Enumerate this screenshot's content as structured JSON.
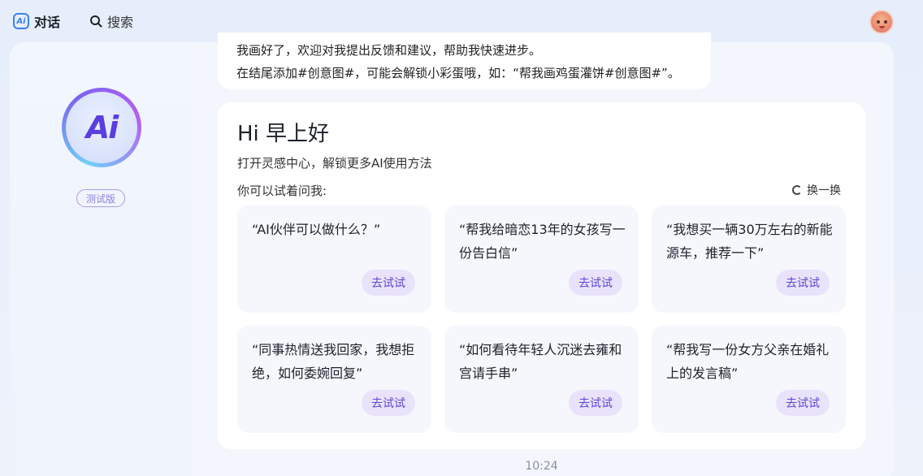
{
  "nav": {
    "logo_text": "Ai",
    "chat_label": "对话",
    "search_label": "搜索"
  },
  "sidebar": {
    "logo_text": "Ai",
    "beta_badge": "测试版"
  },
  "previous_message": {
    "line1": "我画好了，欢迎对我提出反馈和建议，帮助我快速进步。",
    "line2": "在结尾添加#创意图#，可能会解锁小彩蛋哦，如：“帮我画鸡蛋灌饼#创意图#”。"
  },
  "greeting": {
    "title": "Hi 早上好",
    "subtitle": "打开灵感中心，解锁更多AI使用方法",
    "try_label": "你可以试着问我:",
    "refresh_label": "换一换"
  },
  "prompts": [
    {
      "text": "“AI伙伴可以做什么？”",
      "button": "去试试"
    },
    {
      "text": "“帮我给暗恋13年的女孩写一份告白信”",
      "button": "去试试"
    },
    {
      "text": "“我想买一辆30万左右的新能源车，推荐一下”",
      "button": "去试试"
    },
    {
      "text": "“同事热情送我回家，我想拒绝，如何委婉回复”",
      "button": "去试试"
    },
    {
      "text": "“如何看待年轻人沉迷去雍和宫请手串”",
      "button": "去试试"
    },
    {
      "text": "“帮我写一份女方父亲在婚礼上的发言稿”",
      "button": "去试试"
    }
  ],
  "timestamp": "10:24",
  "colors": {
    "accent": "#5f47d8",
    "button_bg": "#e8e3fb",
    "card_bg": "#f5f7fd"
  }
}
